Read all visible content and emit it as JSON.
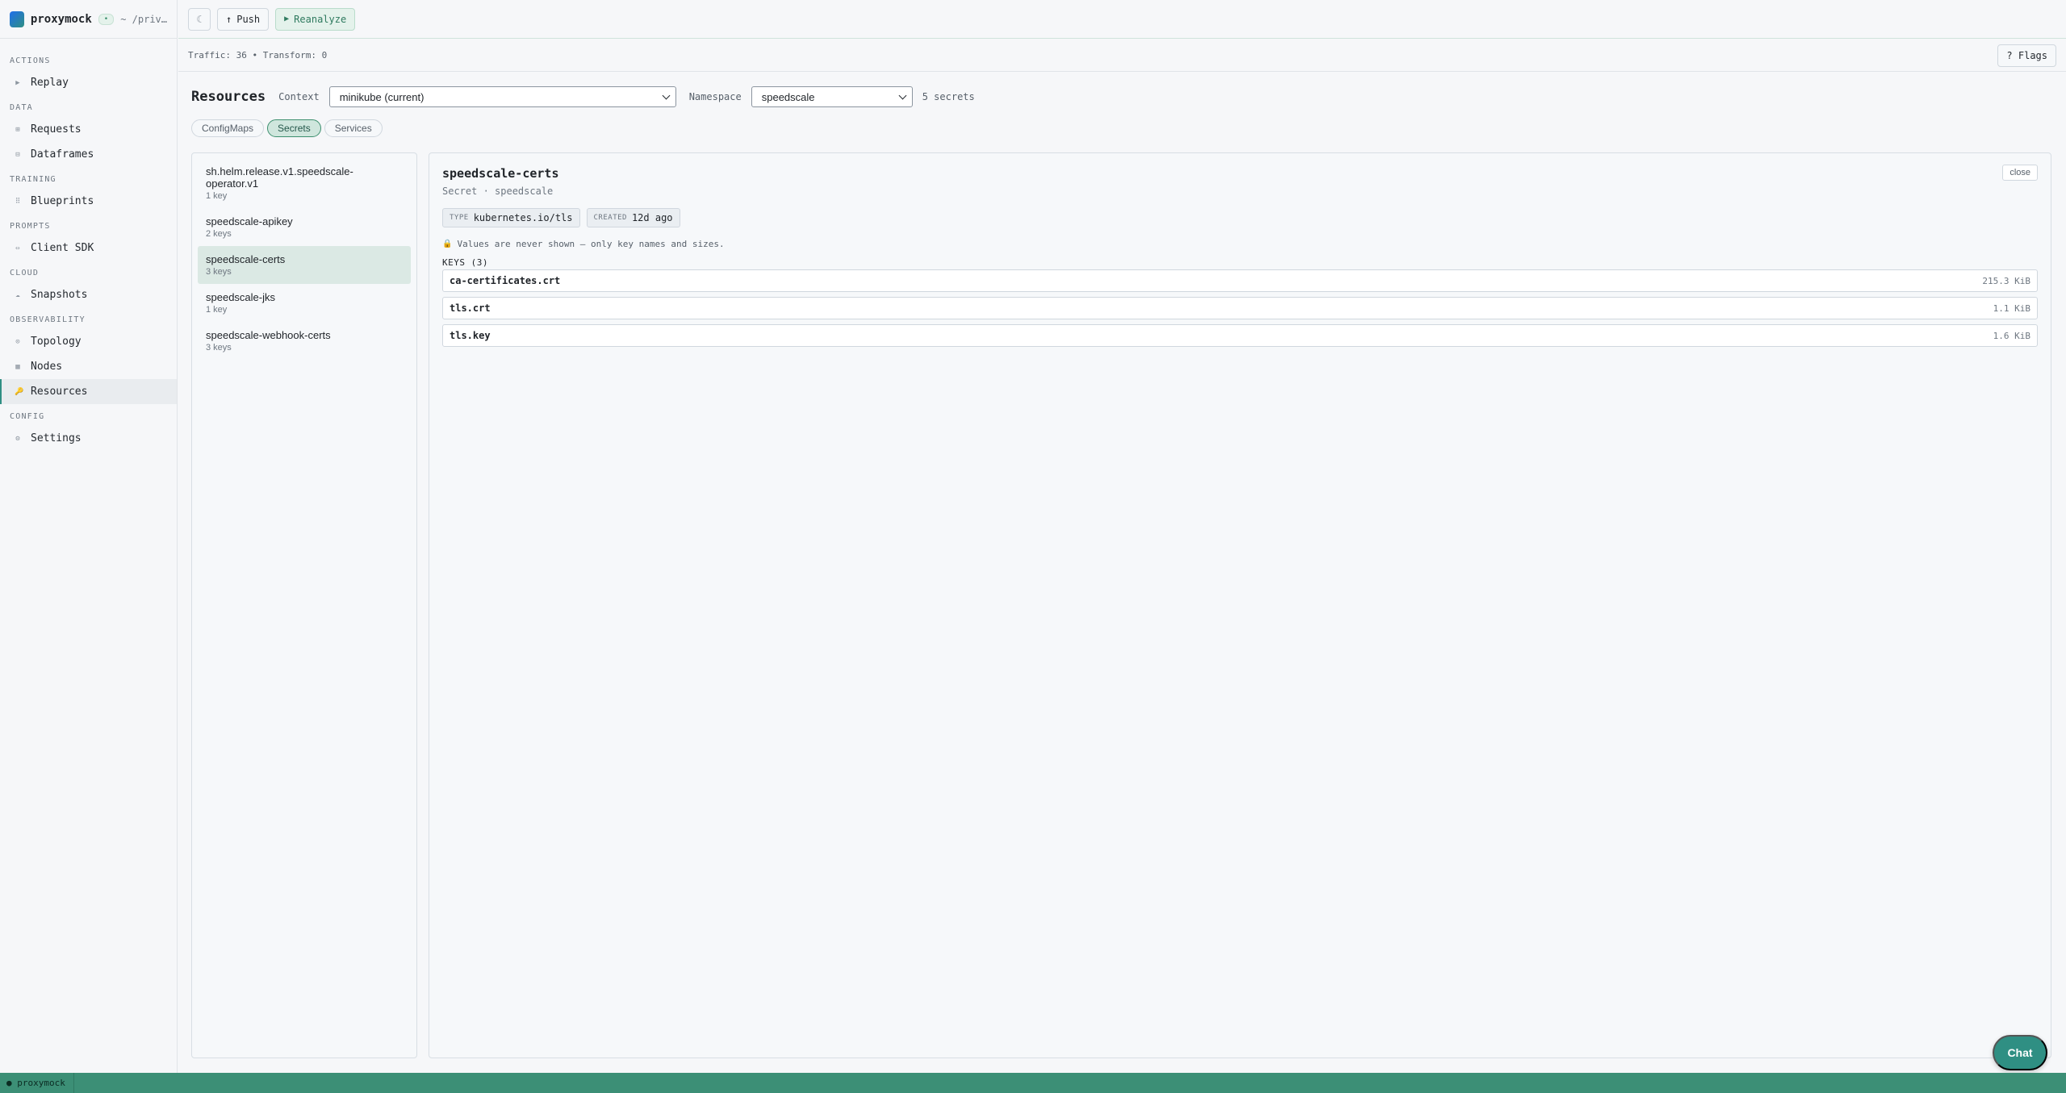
{
  "app": {
    "name": "proxymock",
    "badge": "•",
    "path": "~ /priv…"
  },
  "sidebar": {
    "sections": [
      {
        "title": "ACTIONS",
        "items": [
          {
            "label": "Replay",
            "icon": "▶"
          }
        ]
      },
      {
        "title": "DATA",
        "items": [
          {
            "label": "Requests",
            "icon": "⊞"
          },
          {
            "label": "Dataframes",
            "icon": "⊟"
          }
        ]
      },
      {
        "title": "TRAINING",
        "items": [
          {
            "label": "Blueprints",
            "icon": "⠿"
          }
        ]
      },
      {
        "title": "PROMPTS",
        "items": [
          {
            "label": "Client SDK",
            "icon": "⇔"
          }
        ]
      },
      {
        "title": "CLOUD",
        "items": [
          {
            "label": "Snapshots",
            "icon": "☁"
          }
        ]
      },
      {
        "title": "OBSERVABILITY",
        "items": [
          {
            "label": "Topology",
            "icon": "⊙"
          },
          {
            "label": "Nodes",
            "icon": "▦"
          },
          {
            "label": "Resources",
            "icon": "🔑"
          }
        ]
      },
      {
        "title": "CONFIG",
        "items": [
          {
            "label": "Settings",
            "icon": "⚙"
          }
        ]
      }
    ]
  },
  "topbar": {
    "theme_icon": "☾",
    "push_label": "Push",
    "push_icon": "↑",
    "reanalyze_label": "Reanalyze",
    "reanalyze_icon": "▶"
  },
  "strip": {
    "status": "Traffic: 36 • Transform: 0",
    "flags_label": "? Flags"
  },
  "main": {
    "title": "Resources",
    "context_label": "Context",
    "context_value": "minikube (current)",
    "namespace_label": "Namespace",
    "namespace_value": "speedscale",
    "count_text": "5 secrets",
    "tabs": [
      "ConfigMaps",
      "Secrets",
      "Services"
    ]
  },
  "list": [
    {
      "name": "sh.helm.release.v1.speedscale-operator.v1",
      "sub": "1 key"
    },
    {
      "name": "speedscale-apikey",
      "sub": "2 keys"
    },
    {
      "name": "speedscale-certs",
      "sub": "3 keys"
    },
    {
      "name": "speedscale-jks",
      "sub": "1 key"
    },
    {
      "name": "speedscale-webhook-certs",
      "sub": "3 keys"
    }
  ],
  "detail": {
    "title": "speedscale-certs",
    "subtitle": "Secret · speedscale",
    "close_label": "close",
    "type_key": "TYPE",
    "type_value": "kubernetes.io/tls",
    "created_key": "CREATED",
    "created_value": "12d ago",
    "note": "Values are never shown — only key names and sizes.",
    "lock_icon": "🔒",
    "keys_heading": "KEYS (3)",
    "keys": [
      {
        "name": "ca-certificates.crt",
        "size": "215.3 KiB"
      },
      {
        "name": "tls.crt",
        "size": "1.1 KiB"
      },
      {
        "name": "tls.key",
        "size": "1.6 KiB"
      }
    ]
  },
  "chat_label": "Chat",
  "statusbar": {
    "label": "● proxymock"
  }
}
